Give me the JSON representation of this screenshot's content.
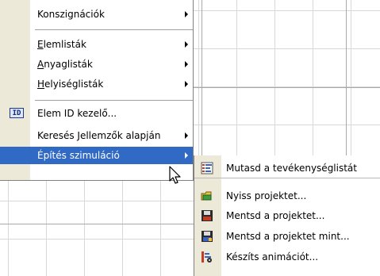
{
  "main_menu": {
    "items": [
      {
        "label": "Konszignációk",
        "has_submenu": true
      },
      {
        "label_accel": "E",
        "label_rest": "lemlisták",
        "has_submenu": true
      },
      {
        "label_accel": "A",
        "label_rest": "nyaglisták",
        "has_submenu": true
      },
      {
        "label_accel": "H",
        "label_rest": "elyiséglisták",
        "has_submenu": true
      },
      {
        "label": "Elem ID kezelő...",
        "icon": "id-icon",
        "icon_text": "ID",
        "has_submenu": false
      },
      {
        "label": "Keresés Jellemzők alapján",
        "has_submenu": true
      },
      {
        "label": "Építés szimuláció",
        "has_submenu": true,
        "selected": true
      }
    ]
  },
  "submenu": {
    "items": [
      {
        "label": "Mutasd a tevékenységlistát",
        "icon": "activity-list-icon"
      },
      {
        "label": "Nyiss projektet...",
        "icon": "open-project-icon"
      },
      {
        "label": "Mentsd a projektet...",
        "icon": "save-project-icon"
      },
      {
        "label": "Mentsd a projektet mint...",
        "icon": "save-project-as-icon"
      },
      {
        "label": "Készíts animációt...",
        "icon": "make-animation-icon"
      }
    ]
  },
  "colors": {
    "selection": "#316ac5",
    "gutter": "#ece9d8",
    "grid": "#d8d8d8"
  }
}
